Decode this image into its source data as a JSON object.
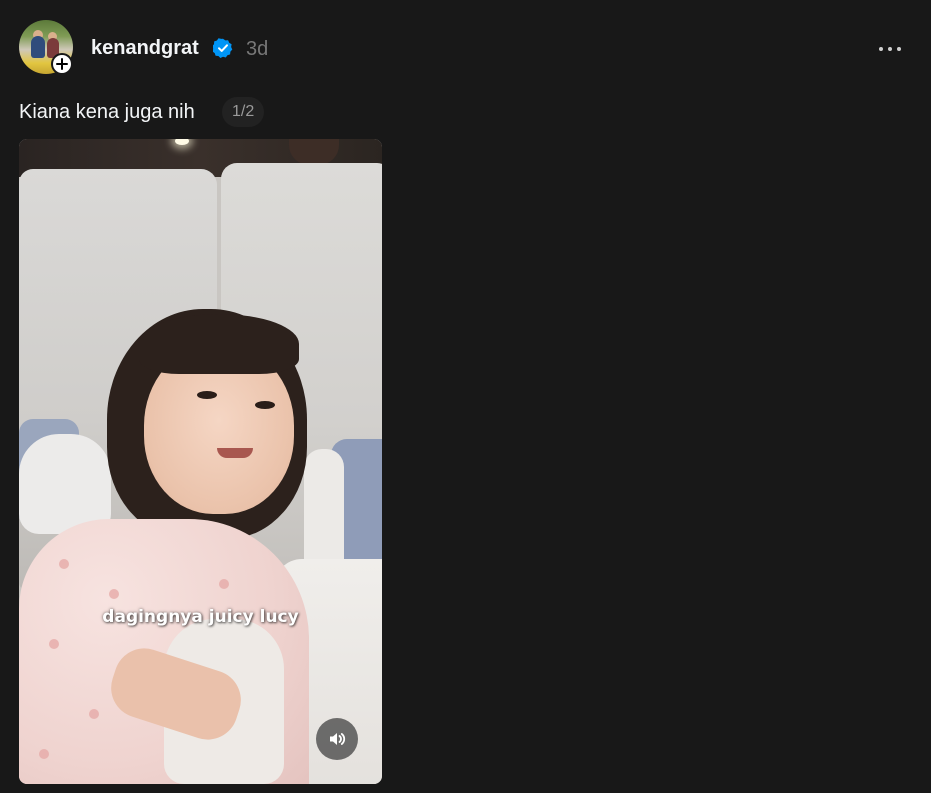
{
  "post": {
    "author": {
      "username": "kenandgrat",
      "verified": true,
      "avatar_icon": "avatar-photo",
      "follow_icon": "plus-icon"
    },
    "timestamp": "3d",
    "more_icon": "more-horizontal-icon",
    "caption": "Kiana kena juga nih",
    "media_counter": "1/2",
    "media": {
      "type": "video",
      "subtitle_text": "dagingnya juicy lucy",
      "sound_icon": "volume-icon"
    }
  },
  "colors": {
    "background": "#181818",
    "primary_text": "#f3f5f7",
    "secondary_text": "#777777",
    "verified_blue": "#0095f6"
  }
}
